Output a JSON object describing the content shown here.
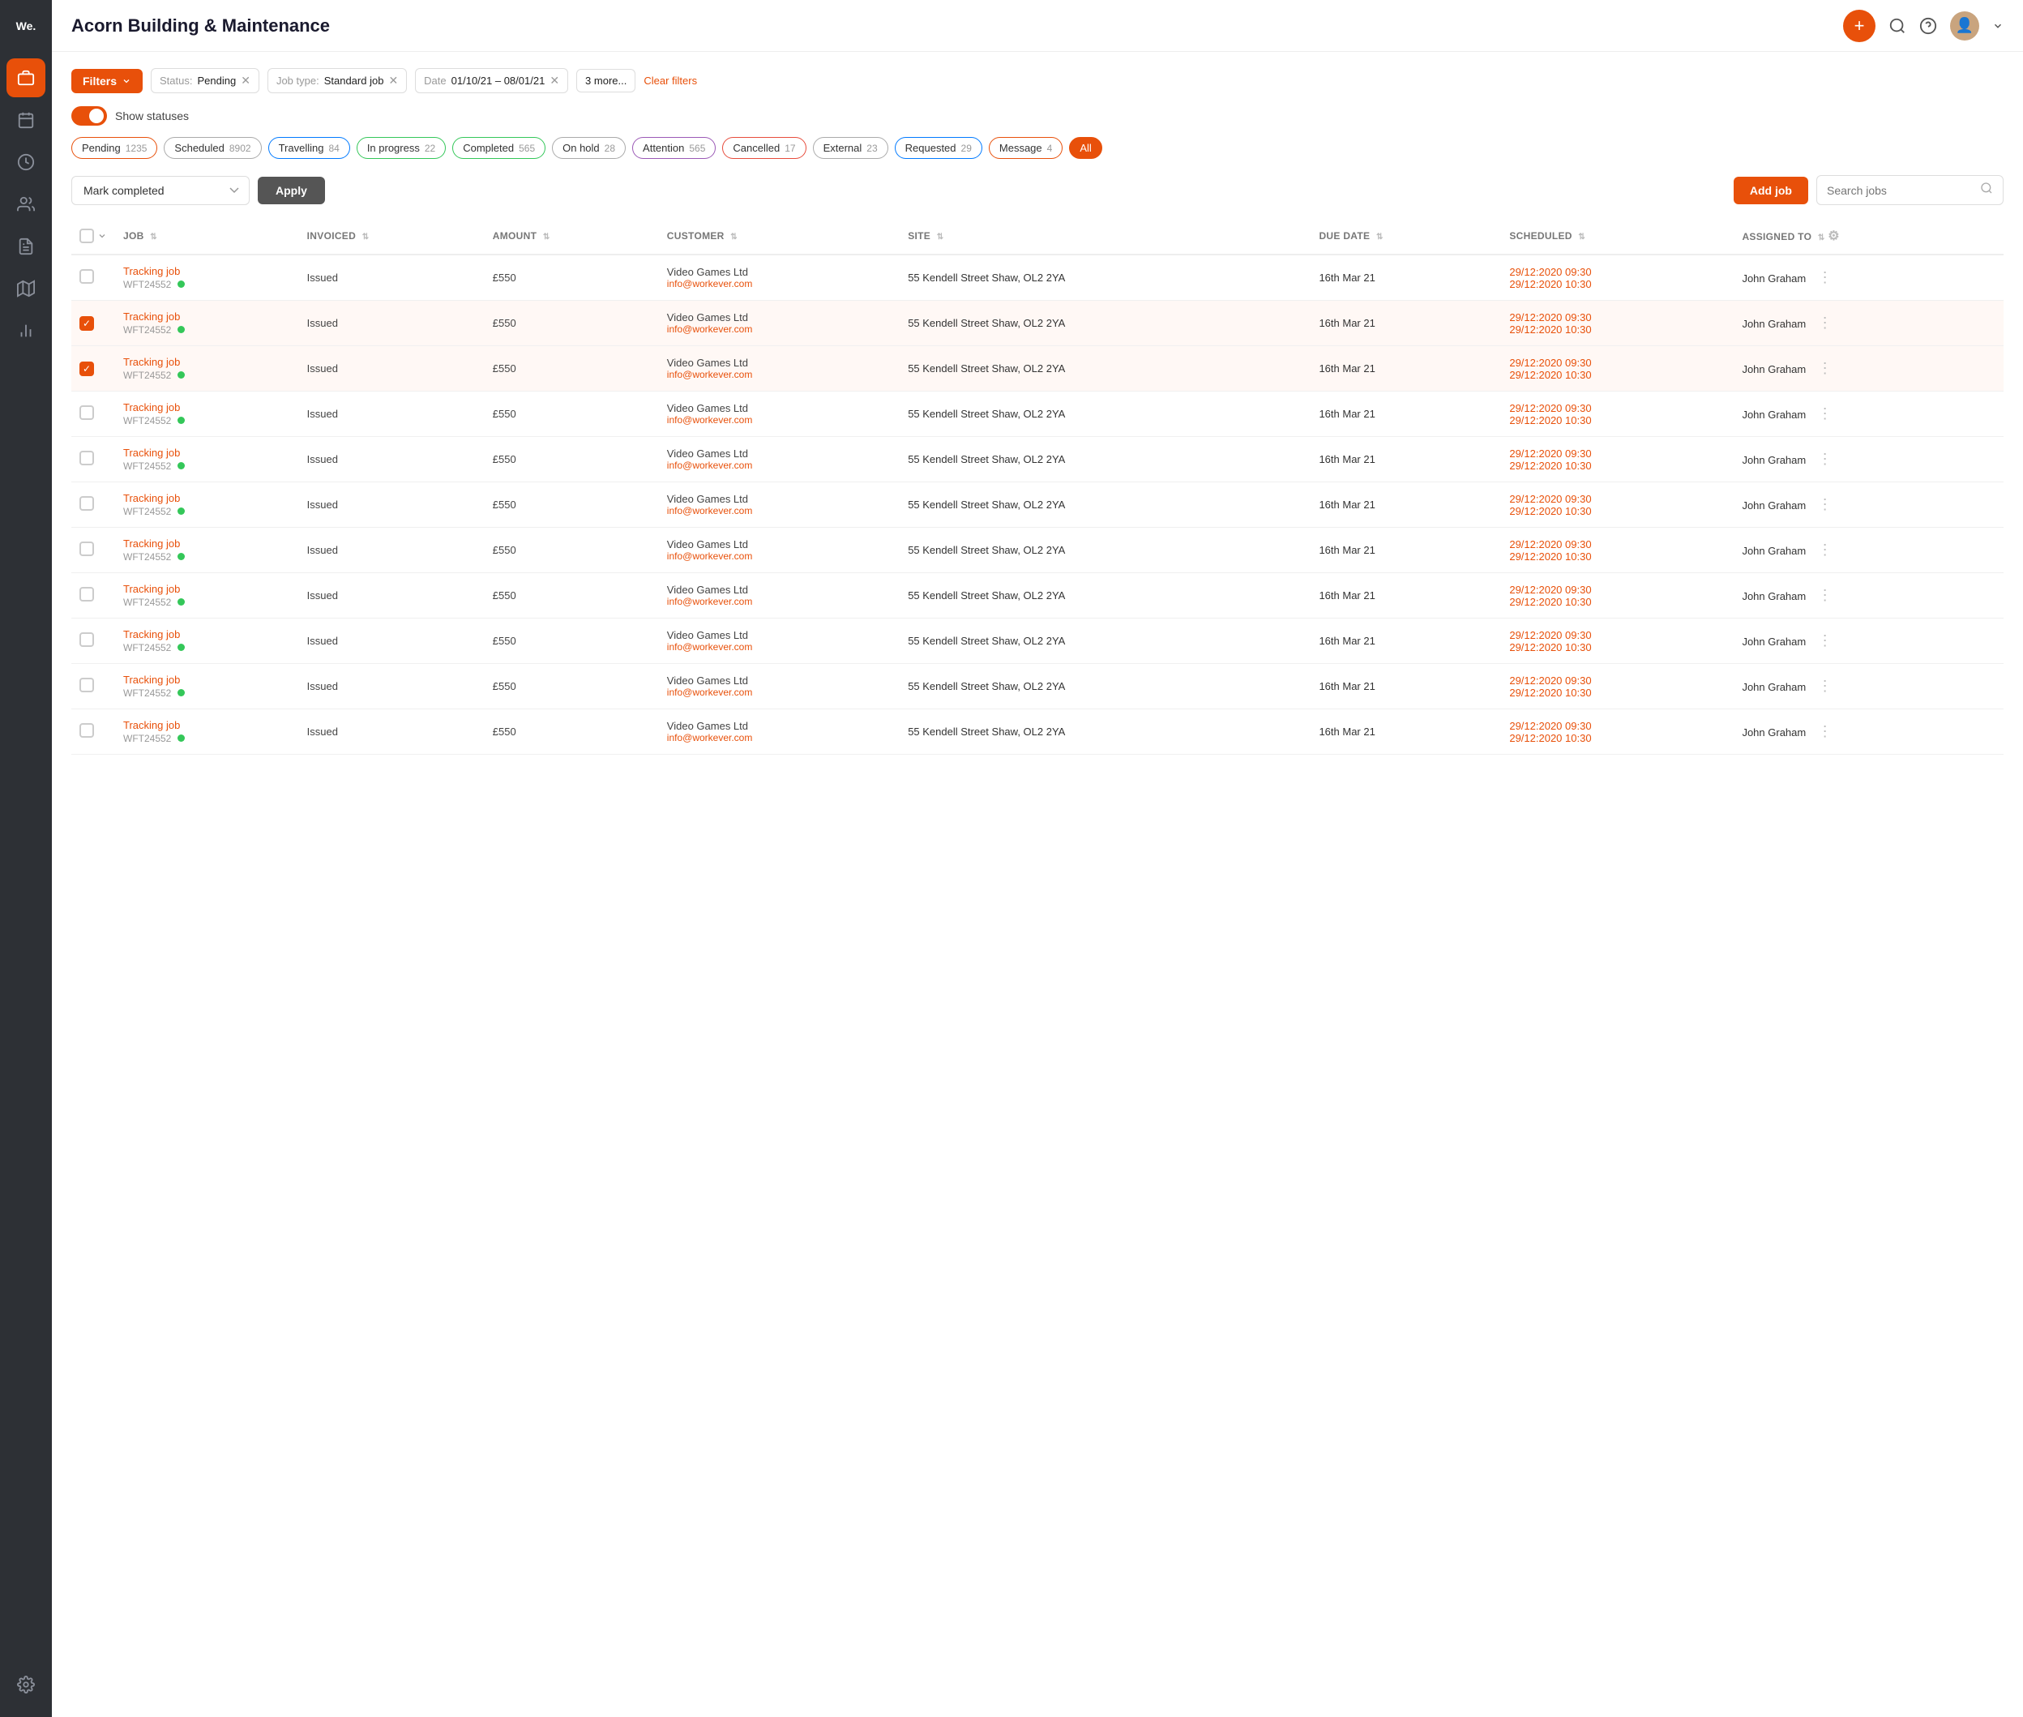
{
  "app": {
    "logo": "We.",
    "title": "Acorn Building & Maintenance"
  },
  "sidebar": {
    "items": [
      {
        "id": "jobs",
        "icon": "💼",
        "active": true
      },
      {
        "id": "calendar",
        "icon": "📅",
        "active": false
      },
      {
        "id": "history",
        "icon": "🕐",
        "active": false
      },
      {
        "id": "contacts",
        "icon": "👥",
        "active": false
      },
      {
        "id": "invoices",
        "icon": "📋",
        "active": false
      },
      {
        "id": "reports",
        "icon": "📊",
        "active": false
      }
    ],
    "bottom": [
      {
        "id": "settings",
        "icon": "⚙️"
      }
    ]
  },
  "filters": {
    "button_label": "Filters",
    "chips": [
      {
        "label": "Status:",
        "value": "Pending",
        "id": "status"
      },
      {
        "label": "Job type:",
        "value": "Standard job",
        "id": "job-type"
      },
      {
        "label": "Date",
        "value": "01/10/21 – 08/01/21",
        "id": "date"
      },
      {
        "label": "3 more...",
        "value": "",
        "id": "more"
      }
    ],
    "clear_label": "Clear filters"
  },
  "toggle": {
    "label": "Show statuses",
    "checked": true
  },
  "status_pills": [
    {
      "name": "Pending",
      "count": "1235",
      "border": "orange-border"
    },
    {
      "name": "Scheduled",
      "count": "8902",
      "border": "gray-border"
    },
    {
      "name": "Travelling",
      "count": "84",
      "border": "blue-border"
    },
    {
      "name": "In progress",
      "count": "22",
      "border": "green-border"
    },
    {
      "name": "Completed",
      "count": "565",
      "border": "green-border"
    },
    {
      "name": "On hold",
      "count": "28",
      "border": "gray-border"
    },
    {
      "name": "Attention",
      "count": "565",
      "border": "purple-border"
    },
    {
      "name": "Cancelled",
      "count": "17",
      "border": "red-border"
    },
    {
      "name": "External",
      "count": "23",
      "border": "gray-border"
    },
    {
      "name": "Requested",
      "count": "29",
      "border": "blue-border"
    },
    {
      "name": "Message",
      "count": "4",
      "border": "orange-border"
    },
    {
      "name": "All",
      "count": "",
      "border": "all-pill",
      "is_all": true
    }
  ],
  "toolbar": {
    "action_placeholder": "Mark completed",
    "apply_label": "Apply",
    "add_job_label": "Add job",
    "search_placeholder": "Search jobs"
  },
  "table": {
    "columns": [
      {
        "id": "job",
        "label": "JOB"
      },
      {
        "id": "invoiced",
        "label": "INVOICED"
      },
      {
        "id": "amount",
        "label": "AMOUNT"
      },
      {
        "id": "customer",
        "label": "CUSTOMER"
      },
      {
        "id": "site",
        "label": "SITE"
      },
      {
        "id": "due_date",
        "label": "DUE DATE"
      },
      {
        "id": "scheduled",
        "label": "SCHEDULED"
      },
      {
        "id": "assigned_to",
        "label": "ASSIGNED TO"
      }
    ],
    "rows": [
      {
        "id": 1,
        "checked": false,
        "job_name": "Tracking job",
        "job_ref": "WFT24552",
        "invoiced": "Issued",
        "amount": "£550",
        "customer_name": "Video Games Ltd",
        "customer_email": "info@workever.com",
        "site": "55 Kendell Street Shaw, OL2 2YA",
        "due_date": "16th Mar 21",
        "scheduled_start": "29/12:2020 09:30",
        "scheduled_end": "29/12:2020 10:30",
        "assigned_to": "John Graham"
      },
      {
        "id": 2,
        "checked": true,
        "job_name": "Tracking job",
        "job_ref": "WFT24552",
        "invoiced": "Issued",
        "amount": "£550",
        "customer_name": "Video Games Ltd",
        "customer_email": "info@workever.com",
        "site": "55 Kendell Street Shaw, OL2 2YA",
        "due_date": "16th Mar 21",
        "scheduled_start": "29/12:2020 09:30",
        "scheduled_end": "29/12:2020 10:30",
        "assigned_to": "John Graham"
      },
      {
        "id": 3,
        "checked": true,
        "job_name": "Tracking job",
        "job_ref": "WFT24552",
        "invoiced": "Issued",
        "amount": "£550",
        "customer_name": "Video Games Ltd",
        "customer_email": "info@workever.com",
        "site": "55 Kendell Street Shaw, OL2 2YA",
        "due_date": "16th Mar 21",
        "scheduled_start": "29/12:2020 09:30",
        "scheduled_end": "29/12:2020 10:30",
        "assigned_to": "John Graham"
      },
      {
        "id": 4,
        "checked": false,
        "job_name": "Tracking job",
        "job_ref": "WFT24552",
        "invoiced": "Issued",
        "amount": "£550",
        "customer_name": "Video Games Ltd",
        "customer_email": "info@workever.com",
        "site": "55 Kendell Street Shaw, OL2 2YA",
        "due_date": "16th Mar 21",
        "scheduled_start": "29/12:2020 09:30",
        "scheduled_end": "29/12:2020 10:30",
        "assigned_to": "John Graham"
      },
      {
        "id": 5,
        "checked": false,
        "job_name": "Tracking job",
        "job_ref": "WFT24552",
        "invoiced": "Issued",
        "amount": "£550",
        "customer_name": "Video Games Ltd",
        "customer_email": "info@workever.com",
        "site": "55 Kendell Street Shaw, OL2 2YA",
        "due_date": "16th Mar 21",
        "scheduled_start": "29/12:2020 09:30",
        "scheduled_end": "29/12:2020 10:30",
        "assigned_to": "John Graham"
      },
      {
        "id": 6,
        "checked": false,
        "job_name": "Tracking job",
        "job_ref": "WFT24552",
        "invoiced": "Issued",
        "amount": "£550",
        "customer_name": "Video Games Ltd",
        "customer_email": "info@workever.com",
        "site": "55 Kendell Street Shaw, OL2 2YA",
        "due_date": "16th Mar 21",
        "scheduled_start": "29/12:2020 09:30",
        "scheduled_end": "29/12:2020 10:30",
        "assigned_to": "John Graham"
      },
      {
        "id": 7,
        "checked": false,
        "job_name": "Tracking job",
        "job_ref": "WFT24552",
        "invoiced": "Issued",
        "amount": "£550",
        "customer_name": "Video Games Ltd",
        "customer_email": "info@workever.com",
        "site": "55 Kendell Street Shaw, OL2 2YA",
        "due_date": "16th Mar 21",
        "scheduled_start": "29/12:2020 09:30",
        "scheduled_end": "29/12:2020 10:30",
        "assigned_to": "John Graham"
      },
      {
        "id": 8,
        "checked": false,
        "job_name": "Tracking job",
        "job_ref": "WFT24552",
        "invoiced": "Issued",
        "amount": "£550",
        "customer_name": "Video Games Ltd",
        "customer_email": "info@workever.com",
        "site": "55 Kendell Street Shaw, OL2 2YA",
        "due_date": "16th Mar 21",
        "scheduled_start": "29/12:2020 09:30",
        "scheduled_end": "29/12:2020 10:30",
        "assigned_to": "John Graham"
      },
      {
        "id": 9,
        "checked": false,
        "job_name": "Tracking job",
        "job_ref": "WFT24552",
        "invoiced": "Issued",
        "amount": "£550",
        "customer_name": "Video Games Ltd",
        "customer_email": "info@workever.com",
        "site": "55 Kendell Street Shaw, OL2 2YA",
        "due_date": "16th Mar 21",
        "scheduled_start": "29/12:2020 09:30",
        "scheduled_end": "29/12:2020 10:30",
        "assigned_to": "John Graham"
      },
      {
        "id": 10,
        "checked": false,
        "job_name": "Tracking job",
        "job_ref": "WFT24552",
        "invoiced": "Issued",
        "amount": "£550",
        "customer_name": "Video Games Ltd",
        "customer_email": "info@workever.com",
        "site": "55 Kendell Street Shaw, OL2 2YA",
        "due_date": "16th Mar 21",
        "scheduled_start": "29/12:2020 09:30",
        "scheduled_end": "29/12:2020 10:30",
        "assigned_to": "John Graham"
      },
      {
        "id": 11,
        "checked": false,
        "job_name": "Tracking job",
        "job_ref": "WFT24552",
        "invoiced": "Issued",
        "amount": "£550",
        "customer_name": "Video Games Ltd",
        "customer_email": "info@workever.com",
        "site": "55 Kendell Street Shaw, OL2 2YA",
        "due_date": "16th Mar 21",
        "scheduled_start": "29/12:2020 09:30",
        "scheduled_end": "29/12:2020 10:30",
        "assigned_to": "John Graham"
      }
    ]
  }
}
